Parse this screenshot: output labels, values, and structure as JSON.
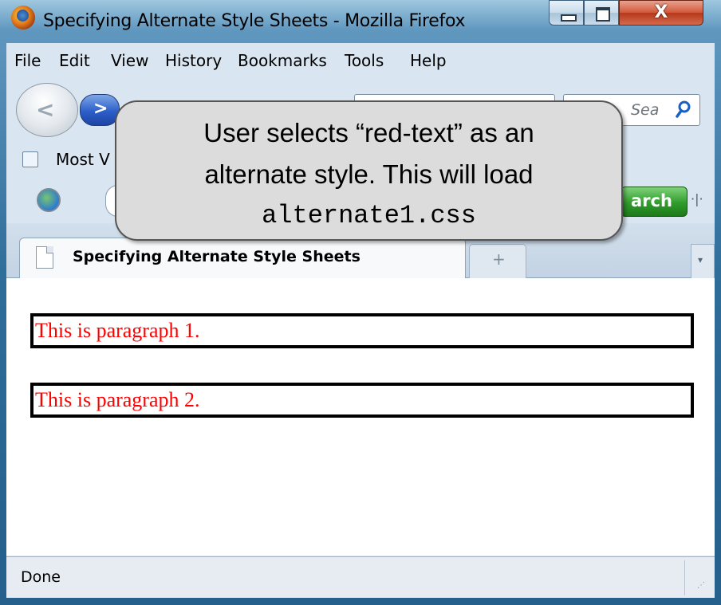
{
  "window": {
    "title": "Specifying Alternate Style Sheets - Mozilla Firefox",
    "close_glyph": "X"
  },
  "menu": {
    "file": "File",
    "edit": "Edit",
    "view": "View",
    "history": "History",
    "bookmarks": "Bookmarks",
    "tools": "Tools",
    "help": "Help"
  },
  "navigation": {
    "back_glyph": "<",
    "forward_glyph": ">",
    "search_placeholder": "Sea",
    "search_icon": "search-icon"
  },
  "bookmarks_bar": {
    "first_item": "Most V"
  },
  "toolbar2": {
    "search_button": "arch"
  },
  "tabs": {
    "active_tab": "Specifying Alternate Style Sheets",
    "new_tab_glyph": "+",
    "list_glyph": "▾"
  },
  "page": {
    "paragraphs": [
      "This is paragraph 1.",
      "This is paragraph 2."
    ],
    "text_color": "#ff0000",
    "border_color": "#000000"
  },
  "status": {
    "text": "Done"
  },
  "callout": {
    "line1": "User selects “red-text” as an",
    "line2": "alternate style.  This will load",
    "line3": "alternate1.css"
  }
}
